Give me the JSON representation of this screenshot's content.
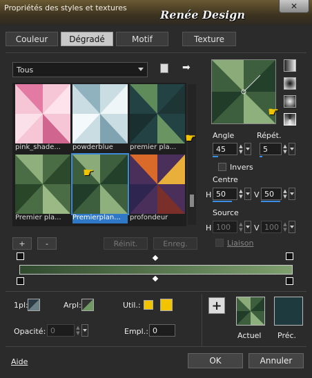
{
  "window": {
    "title": "Propriétés des styles et textures",
    "watermark": "Renée Design",
    "close_label": "✕"
  },
  "tabs": [
    {
      "label": "Couleur"
    },
    {
      "label": "Dégradé"
    },
    {
      "label": "Motif"
    },
    {
      "label": "Texture"
    }
  ],
  "library": {
    "selected": "Tous"
  },
  "thumbnails": [
    {
      "label": "pink_shade..."
    },
    {
      "label": "powderblue"
    },
    {
      "label": "premier pla..."
    },
    {
      "label": "Premier pla..."
    },
    {
      "label": "Premierplan..."
    },
    {
      "label": "profondeur"
    }
  ],
  "buttons": {
    "add": "+",
    "remove": "-",
    "reset": "Réinit.",
    "save": "Enreg.",
    "ok": "OK",
    "cancel": "Annuler",
    "help": "Aide"
  },
  "params": {
    "angle_label": "Angle",
    "angle": "45",
    "repeat_label": "Répét.",
    "repeat": "5",
    "invert_label": "Invers",
    "center_label": "Centre",
    "h_label": "H",
    "v_label": "V",
    "center_h": "50",
    "center_v": "50",
    "source_label": "Source",
    "source_h": "100",
    "source_v": "100",
    "link_label": "Liaison"
  },
  "footer": {
    "fg_label": "1pl:",
    "bg_label": "Arpl:",
    "use_label": "Util.:",
    "opacity_label": "Opacité:",
    "opacity": "0",
    "location_label": "Empl.:",
    "location": "0",
    "current_label": "Actuel",
    "previous_label": "Préc."
  },
  "colors": {
    "accent": "#3c8ad8",
    "dark_green": "#2f4a2e",
    "light_green": "#7f9f6e",
    "teal": "#1f3a3e",
    "gold": "#f2c400"
  }
}
